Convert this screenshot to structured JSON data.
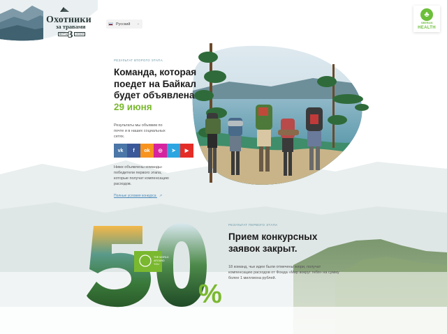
{
  "logo": {
    "title": "Охотники",
    "subtitle": "за травами",
    "number": "3",
    "tag_left": "ВЕРТА",
    "tag_right": "СЕЗОН"
  },
  "language": {
    "selected": "Русский"
  },
  "badge": {
    "small": "SIBERIAN",
    "large": "HEALTH"
  },
  "section1": {
    "eyebrow": "РЕЗУЛЬТАТ ВТОРОГО ЭТАПА",
    "headline_lines": [
      "Команда, которая",
      "поедет на Байкал",
      "будет объявлена"
    ],
    "headline_date": "29 июня",
    "results_lines": [
      "Результаты мы объявим по",
      "почте и в наших социальных",
      "сетях."
    ],
    "socials": [
      {
        "name": "vk",
        "label": "vk",
        "color": "#4a76a8"
      },
      {
        "name": "facebook",
        "label": "f",
        "color": "#3b5998"
      },
      {
        "name": "odnoklassniki",
        "label": "ok",
        "color": "#f7931e"
      },
      {
        "name": "instagram",
        "label": "◎",
        "color": "#d6249f"
      },
      {
        "name": "telegram",
        "label": "➤",
        "color": "#2ca5e0"
      },
      {
        "name": "youtube",
        "label": "▶",
        "color": "#e52d27"
      }
    ],
    "info_lines": [
      "Ниже объявлены команды-",
      "победители первого этапа,",
      "которые получат компенсацию",
      "расходов."
    ],
    "rules_link": "Полные условия конкурса"
  },
  "section2": {
    "eyebrow": "РЕЗУЛЬТАТ ПЕРВОГО ЭТАПА",
    "headline_lines": [
      "Прием конкурсных",
      "заявок закрыт."
    ],
    "body_lines": [
      "18 команд, чьи идеи были отмечены жюри, получат",
      "компенсацию расходов от Фонда «Мир вокруг тебя» на сумму",
      "более 1 миллиона рублей."
    ],
    "big_number": "50",
    "percent": "%",
    "fund_badge": [
      "THE WORLD",
      "AROUND",
      "YOU"
    ]
  },
  "colors": {
    "accent_green": "#7ab82f",
    "link_blue": "#4a8ab8",
    "eyebrow_blue": "#6a98a8"
  }
}
